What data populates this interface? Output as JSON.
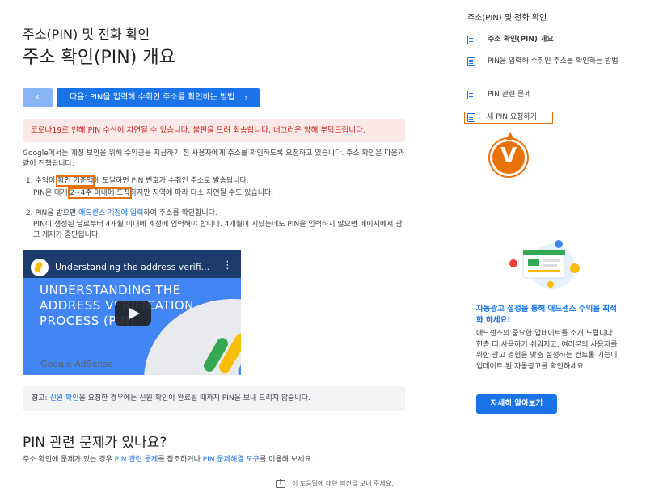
{
  "main": {
    "breadcrumb": "주소(PIN) 및 전화 확인",
    "title": "주소 확인(PIN) 개요",
    "prev_label": "‹",
    "next_label": "다음: PIN을 입력해 수취인 주소를 확인하는 방법",
    "next_chevron": "›",
    "alert": "코로나19로 인해 PIN 수신이 지연될 수 있습니다. 불편을 드려 죄송합니다. 너그러운 양해 부탁드립니다.",
    "intro": "Google에서는 계정 보안을 위해 수익금을 지급하기 전 사용자에게 주소를 확인하도록 요청하고 있습니다. 주소 확인은 다음과 같이 진행됩니다.",
    "step1": {
      "a": "1. 수익이 ",
      "hl1": "확인 기준액",
      "b": "에 도달하면 PIN 번호가 수취인 주소로 발송됩니다.",
      "c": "PIN은 대개 ",
      "hl2": "2~4주 이내에 도착",
      "d": "하지만 지역에 따라 다소 지연될 수도 있습니다."
    },
    "step2": {
      "a": "2. PIN을 받으면 ",
      "link": "애드센스 계정에 입력",
      "b": "하여 주소를 확인합니다.",
      "sub": "PIN이 생성된 날로부터 4개월 이내에 계정에 입력해야 합니다. 4개월이 지났는데도 PIN을 입력하지 않으면 페이지에서 광고 게재가 중단됩니다."
    },
    "video": {
      "title": "Understanding the address verifi...",
      "kebab": "⋮",
      "big_text": "UNDERSTANDING THE ADDRESS VERIFICATION PROCESS (PIN)",
      "brand": "Google AdSense"
    },
    "note": {
      "a": "참고: ",
      "link": "신원 확인",
      "b": "을 요청한 경우에는 신원 확인이 완료될 때까지 PIN을 보내 드리지 않습니다."
    },
    "h2": "PIN 관련 문제가 있나요?",
    "p2": {
      "a": "주소 확인에 문제가 있는 경우 ",
      "link1": "PIN 관련 문제",
      "b": "를 참조하거나 ",
      "link2": "PIN 문제해결 도구",
      "c": "를 이용해 보세요."
    },
    "feedback": "이 도움말에 대한 의견을 보내 주세요."
  },
  "sidebar": {
    "title": "주소(PIN) 및 전화 확인",
    "items": [
      {
        "label": "주소 확인(PIN) 개요",
        "bold": true
      },
      {
        "label": "PIN을 입력해 수취인 주소를 확인하는 방법"
      },
      {
        "label": "PIN 관련 문제"
      },
      {
        "label": "새 PIN 요청하기"
      }
    ],
    "marker": "V",
    "promo_title": "자동광고 설정을 통해 애드센스 수익을 최적화 하세요!",
    "promo_body": "애드센스의 중요한 업데이트를 소개 드립니다. 한층 더 사용하기 쉬워지고, 여러분의 사용자를 위한 광고 경험을 맞춤 설정하는 컨트롤 기능이 업데이트 된 자동광고를 확인하세요.",
    "promo_button": "자세히 알아보기"
  },
  "colors": {
    "primary": "#1a73e8",
    "alert_bg": "#fce8e6",
    "alert_text": "#c5221f",
    "highlight": "#e8710a"
  }
}
